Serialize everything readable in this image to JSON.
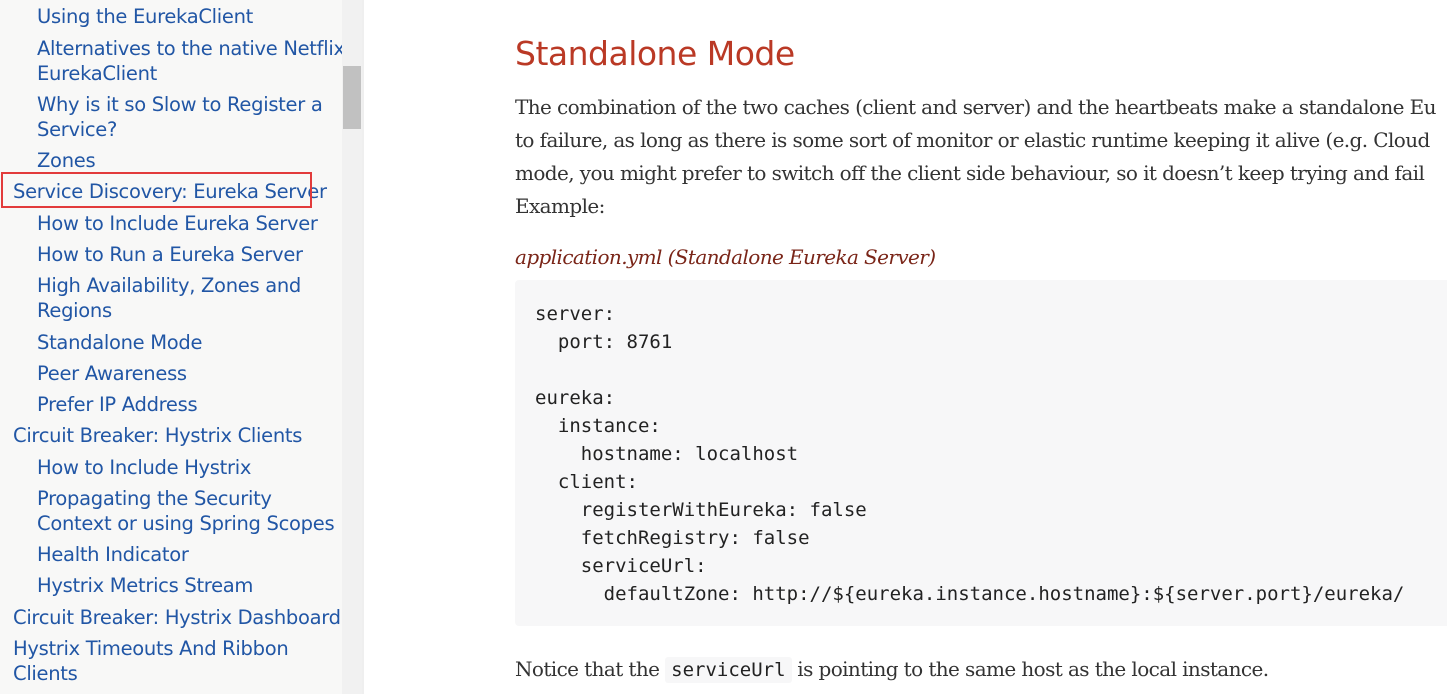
{
  "sidebar": {
    "items": [
      {
        "label": "Using the EurekaClient"
      },
      {
        "label": "Alternatives to the native Netflix"
      },
      {
        "label": "EurekaClient"
      },
      {
        "label": "Why is it so Slow to Register a"
      },
      {
        "label": "Service?"
      },
      {
        "label": "Zones"
      },
      {
        "label": "Service Discovery: Eureka Server"
      },
      {
        "label": "How to Include Eureka Server"
      },
      {
        "label": "How to Run a Eureka Server"
      },
      {
        "label": "High Availability, Zones and"
      },
      {
        "label": "Regions"
      },
      {
        "label": "Standalone Mode"
      },
      {
        "label": "Peer Awareness"
      },
      {
        "label": "Prefer IP Address"
      },
      {
        "label": "Circuit Breaker: Hystrix Clients"
      },
      {
        "label": "How to Include Hystrix"
      },
      {
        "label": "Propagating the Security"
      },
      {
        "label": "Context or using Spring Scopes"
      },
      {
        "label": "Health Indicator"
      },
      {
        "label": "Hystrix Metrics Stream"
      },
      {
        "label": "Circuit Breaker: Hystrix Dashboard"
      },
      {
        "label": "Hystrix Timeouts And Ribbon"
      },
      {
        "label": "Clients"
      }
    ]
  },
  "content": {
    "title": "Standalone Mode",
    "para1_lines": [
      "The combination of the two caches (client and server) and the heartbeats make a standalone Eu",
      "to failure, as long as there is some sort of monitor or elastic runtime keeping it alive (e.g. Cloud",
      "mode, you might prefer to switch off the client side behaviour, so it doesn’t keep trying and fail",
      "Example:"
    ],
    "listing_title": "application.yml (Standalone Eureka Server)",
    "code": "server:\n  port: 8761\n\neureka:\n  instance:\n    hostname: localhost\n  client:\n    registerWithEureka: false\n    fetchRegistry: false\n    serviceUrl:\n      defaultZone: http://${eureka.instance.hostname}:${server.port}/eureka/",
    "para2_before": "Notice that the ",
    "para2_code": "serviceUrl",
    "para2_after": " is pointing to the same host as the local instance."
  },
  "colors": {
    "link": "#2156a5",
    "heading": "#ba3925",
    "highlight_border": "#e23b3b"
  }
}
